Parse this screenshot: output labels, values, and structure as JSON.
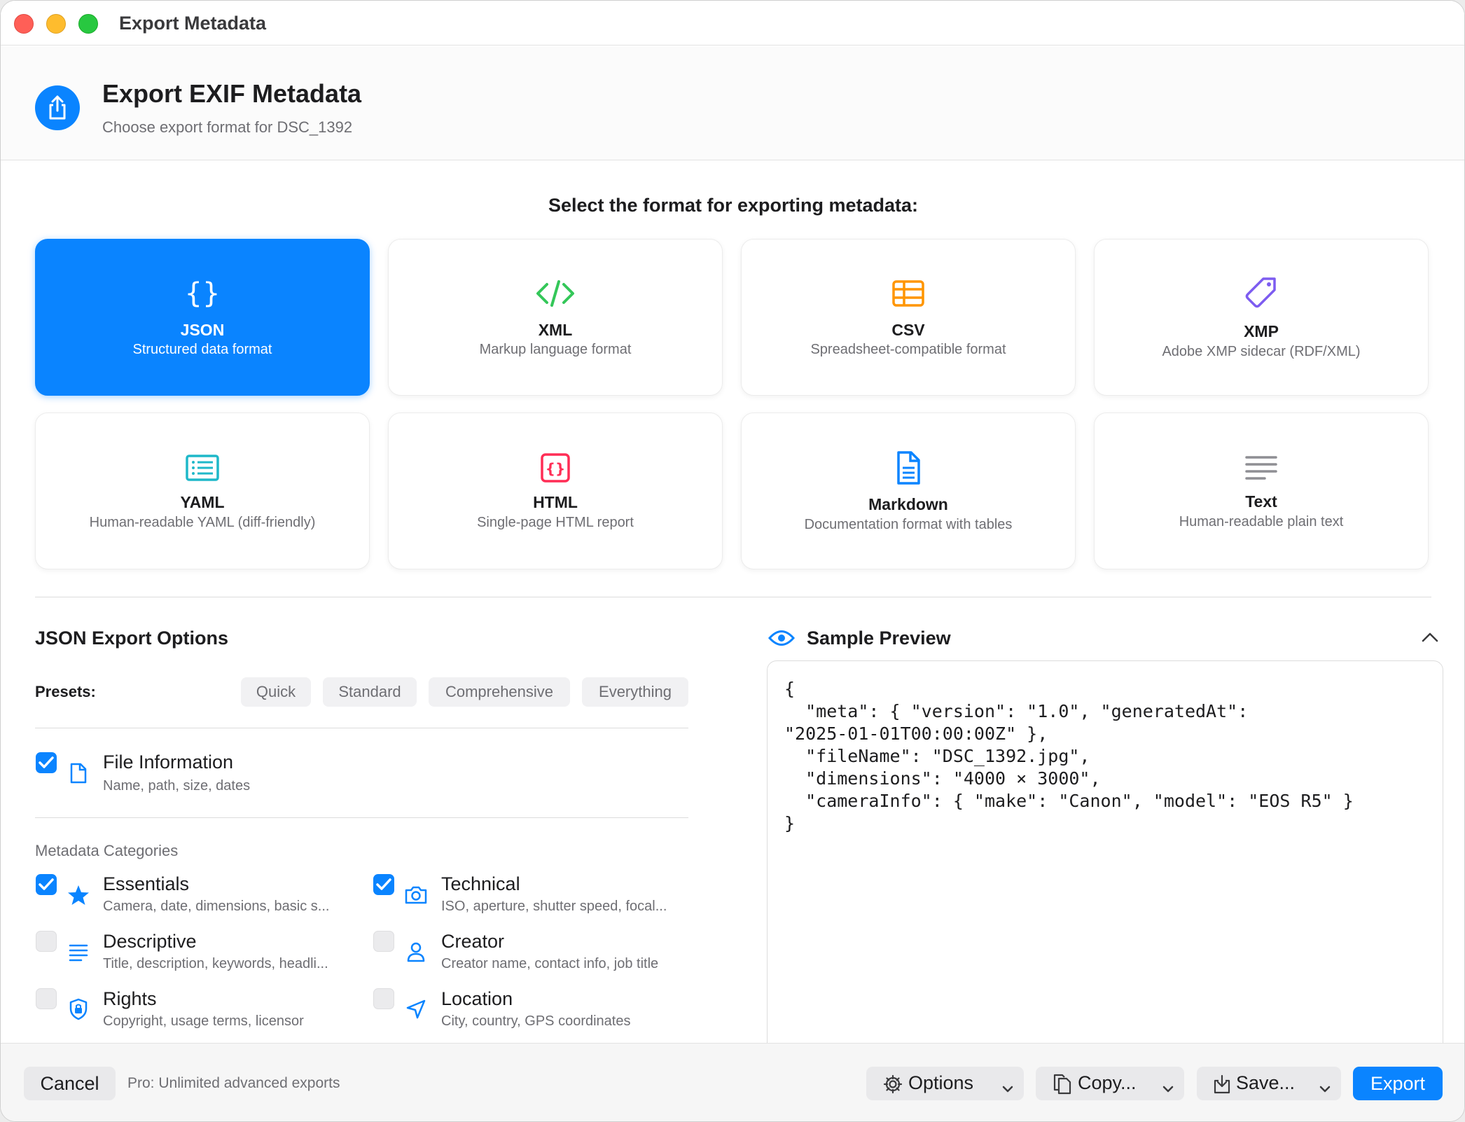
{
  "window": {
    "title": "Export Metadata"
  },
  "header": {
    "title": "Export EXIF Metadata",
    "subtitle": "Choose export format for DSC_1392",
    "icon": "share-icon"
  },
  "format_heading": "Select the format for exporting metadata:",
  "formats": [
    {
      "name": "JSON",
      "desc": "Structured data format",
      "icon": "braces-icon",
      "color": "#ffffff",
      "selected": true
    },
    {
      "name": "XML",
      "desc": "Markup language format",
      "icon": "code-icon",
      "color": "#34c759",
      "selected": false
    },
    {
      "name": "CSV",
      "desc": "Spreadsheet-compatible format",
      "icon": "table-icon",
      "color": "#ff9500",
      "selected": false
    },
    {
      "name": "XMP",
      "desc": "Adobe XMP sidecar (RDF/XML)",
      "icon": "tag-icon",
      "color": "#7d5cf0",
      "selected": false
    },
    {
      "name": "YAML",
      "desc": "Human-readable YAML (diff-friendly)",
      "icon": "list-doc-icon",
      "color": "#1fb8c9",
      "selected": false
    },
    {
      "name": "HTML",
      "desc": "Single-page HTML report",
      "icon": "html-braces-icon",
      "color": "#ff2d55",
      "selected": false
    },
    {
      "name": "Markdown",
      "desc": "Documentation format with tables",
      "icon": "document-icon",
      "color": "#0a84ff",
      "selected": false
    },
    {
      "name": "Text",
      "desc": "Human-readable plain text",
      "icon": "text-lines-icon",
      "color": "#8e8e93",
      "selected": false
    }
  ],
  "options": {
    "title": "JSON Export Options",
    "presets_label": "Presets:",
    "presets": [
      "Quick",
      "Standard",
      "Comprehensive",
      "Everything"
    ],
    "file_info": {
      "title": "File Information",
      "desc": "Name, path, size, dates",
      "checked": true
    },
    "categories_label": "Metadata Categories",
    "categories": [
      {
        "title": "Essentials",
        "desc": "Camera, date, dimensions, basic s...",
        "checked": true,
        "icon": "star-icon"
      },
      {
        "title": "Technical",
        "desc": "ISO, aperture, shutter speed, focal...",
        "checked": true,
        "icon": "camera-icon"
      },
      {
        "title": "Descriptive",
        "desc": "Title, description, keywords, headli...",
        "checked": false,
        "icon": "text-align-icon"
      },
      {
        "title": "Creator",
        "desc": "Creator name, contact info, job title",
        "checked": false,
        "icon": "person-icon"
      },
      {
        "title": "Rights",
        "desc": "Copyright, usage terms, licensor",
        "checked": false,
        "icon": "lock-shield-icon"
      },
      {
        "title": "Location",
        "desc": "City, country, GPS coordinates",
        "checked": false,
        "icon": "location-arrow-icon"
      }
    ]
  },
  "preview": {
    "title": "Sample Preview",
    "code": "{\n  \"meta\": { \"version\": \"1.0\", \"generatedAt\":\n\"2025-01-01T00:00:00Z\" },\n  \"fileName\": \"DSC_1392.jpg\",\n  \"dimensions\": \"4000 × 3000\",\n  \"cameraInfo\": { \"make\": \"Canon\", \"model\": \"EOS R5\" }\n}"
  },
  "footer": {
    "cancel": "Cancel",
    "pro_note": "Pro: Unlimited advanced exports",
    "options": "Options",
    "copy": "Copy...",
    "save": "Save...",
    "export": "Export"
  },
  "colors": {
    "accent": "#0a84ff"
  }
}
